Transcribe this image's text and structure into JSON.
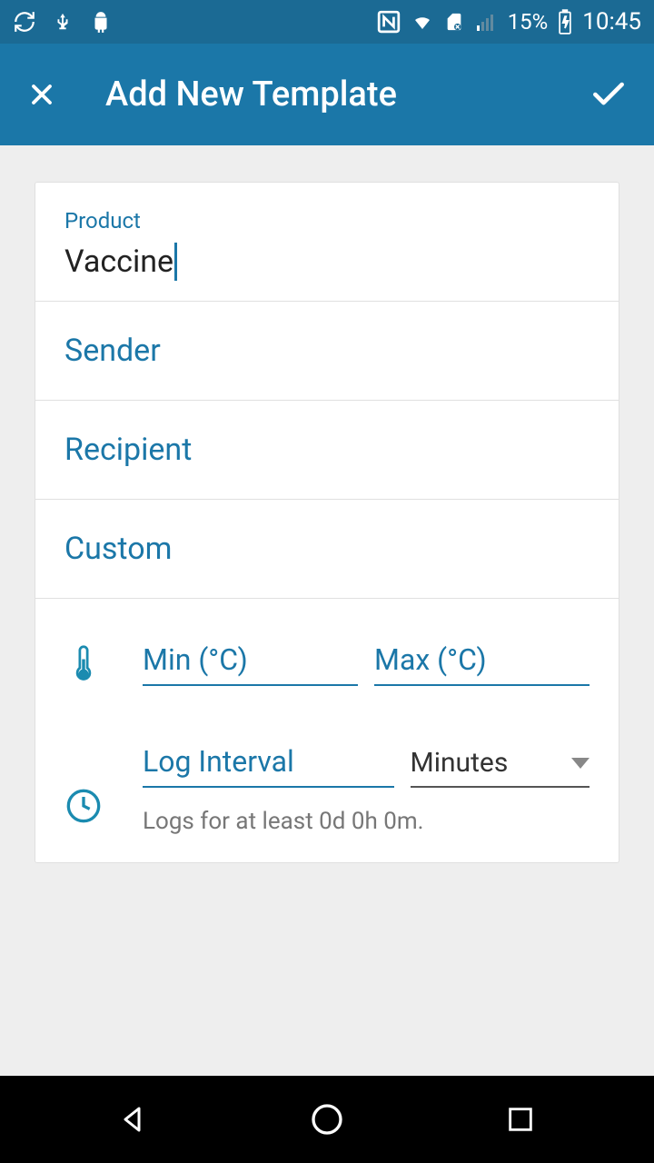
{
  "status": {
    "time": "10:45",
    "battery_pct": "15%"
  },
  "header": {
    "title": "Add New Template"
  },
  "form": {
    "product_label": "Product",
    "product_value": "Vaccine",
    "sender_label": "Sender",
    "recipient_label": "Recipient",
    "custom_label": "Custom",
    "min_placeholder": "Min (°C)",
    "max_placeholder": "Max (°C)",
    "log_interval_placeholder": "Log Interval",
    "unit_selected": "Minutes",
    "log_hint": "Logs for at least 0d 0h 0m."
  },
  "colors": {
    "primary": "#1b77a8",
    "status_bar": "#1b6a94"
  }
}
